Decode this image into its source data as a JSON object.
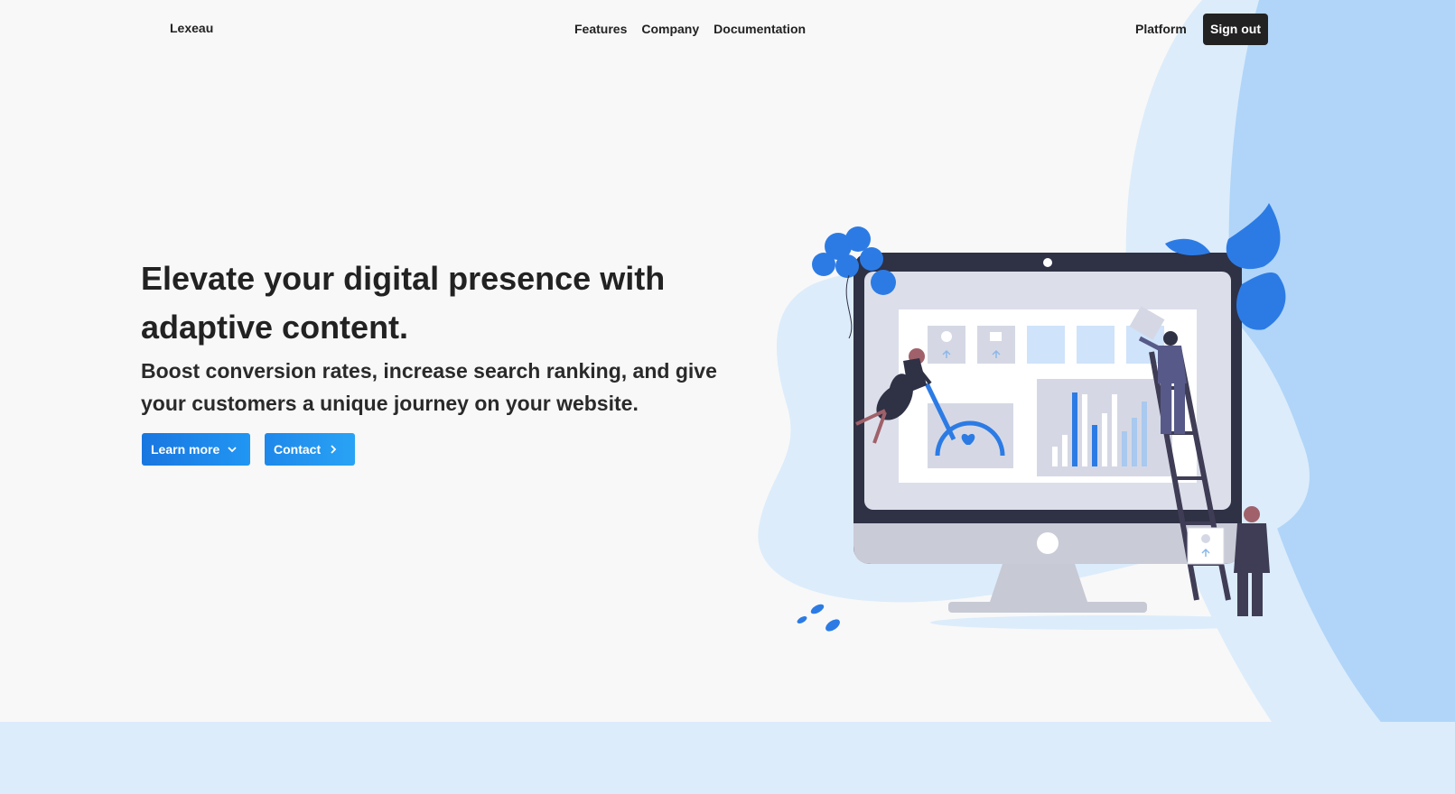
{
  "nav": {
    "brand": "Lexeau",
    "links": [
      "Features",
      "Company",
      "Documentation"
    ],
    "platform": "Platform",
    "signout": "Sign out"
  },
  "hero": {
    "title": "Elevate your digital presence with adaptive content.",
    "subtitle": "Boost conversion rates, increase search ranking, and give your customers a unique journey on your website.",
    "learn_more": "Learn more",
    "contact": "Contact"
  },
  "icons": {
    "learn_more": "chevron-down-icon",
    "contact": "chevron-right-icon"
  },
  "colors": {
    "primary": "#1976e0",
    "accent_blue": "#2196f3",
    "dark": "#222222",
    "light_blue": "#dcecfb",
    "mid_blue": "#b0d5f8"
  }
}
